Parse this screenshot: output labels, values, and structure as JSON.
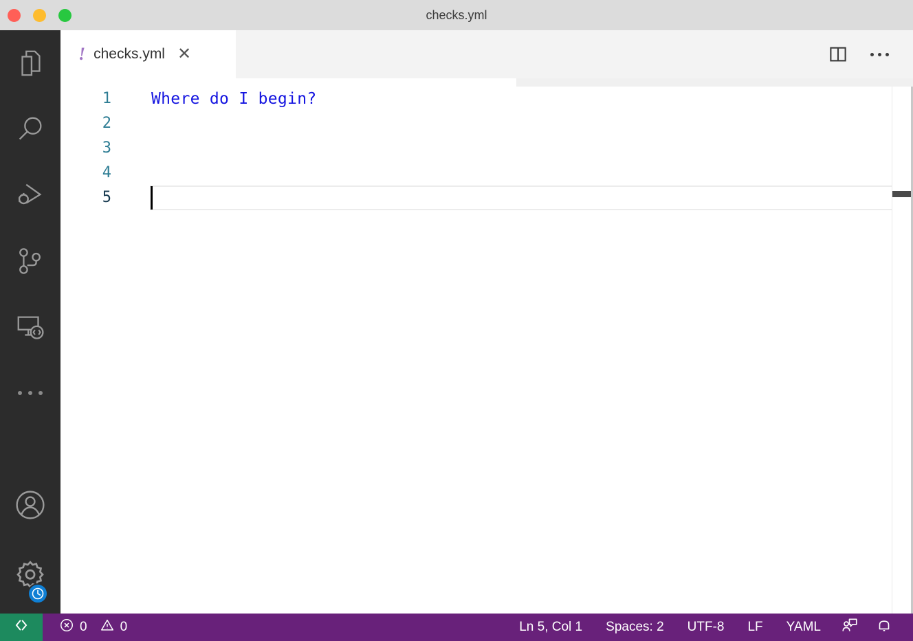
{
  "window": {
    "title": "checks.yml",
    "traffic_lights": [
      {
        "name": "close",
        "color": "#ff5f57"
      },
      {
        "name": "minimize",
        "color": "#febc2e"
      },
      {
        "name": "maximize",
        "color": "#28c840"
      }
    ]
  },
  "activity_bar": {
    "items": [
      {
        "icon": "explorer-files-icon",
        "label": "Explorer"
      },
      {
        "icon": "search-icon",
        "label": "Search"
      },
      {
        "icon": "run-and-debug-icon",
        "label": "Run and Debug"
      },
      {
        "icon": "source-control-branch-icon",
        "label": "Source Control"
      },
      {
        "icon": "remote-explorer-icon",
        "label": "Remote Explorer"
      },
      {
        "icon": "additional-views-ellipsis-icon",
        "label": "Additional Views"
      }
    ],
    "bottom_items": [
      {
        "icon": "account-person-icon",
        "label": "Accounts"
      },
      {
        "icon": "settings-gear-icon",
        "label": "Manage",
        "badge": "pending-update-clock-badge",
        "badge_color": "#0f7fd4"
      }
    ]
  },
  "editor": {
    "tab": {
      "file_icon": "yaml-exclamation-icon",
      "file_icon_glyph": "!",
      "file_icon_color": "#a074c4",
      "label": "checks.yml",
      "close_glyph": "✕"
    },
    "actions": [
      {
        "icon": "split-editor-right-icon",
        "label": "Split Editor Right"
      },
      {
        "icon": "more-actions-ellipsis-icon",
        "label": "More Actions..."
      }
    ],
    "line_numbers": [
      "1",
      "2",
      "3",
      "4",
      "5"
    ],
    "active_line_number": "5",
    "lines": [
      {
        "number": "1",
        "text": "Where do I begin?",
        "color": "#1414e0"
      },
      {
        "number": "2",
        "text": "",
        "color": "#1414e0"
      },
      {
        "number": "3",
        "text": "",
        "color": "#1414e0"
      },
      {
        "number": "4",
        "text": "",
        "color": "#1414e0"
      },
      {
        "number": "5",
        "text": "",
        "color": "#1414e0"
      }
    ]
  },
  "status_bar": {
    "remote_indicator": {
      "icon": "remote-open-icon",
      "label": ""
    },
    "problems": {
      "error_icon": "error-circle-icon",
      "error_count": "0",
      "warning_icon": "warning-triangle-icon",
      "warning_count": "0"
    },
    "cursor_position": "Ln 5, Col 1",
    "indentation": "Spaces: 2",
    "encoding": "UTF-8",
    "eol": "LF",
    "language_mode": "YAML",
    "feedback_icon": "feedback-person-speech-icon",
    "notifications_icon": "bell-icon",
    "background_color": "#68217a",
    "remote_background_color": "#1d8a5e"
  }
}
